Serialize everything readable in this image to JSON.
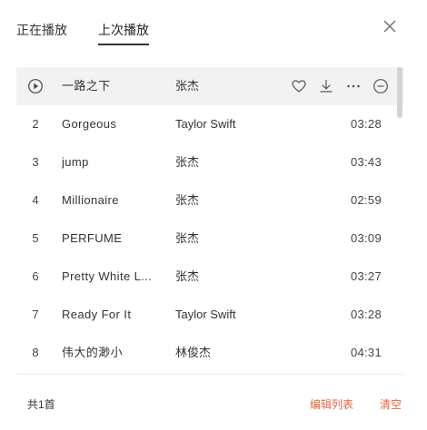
{
  "tabs": [
    {
      "label": "正在播放",
      "active": false
    },
    {
      "label": "上次播放",
      "active": true
    }
  ],
  "icons": {
    "close": "close-icon",
    "play": "play-circle-icon",
    "like": "heart-icon",
    "download": "download-icon",
    "more": "more-icon",
    "remove": "remove-circle-icon"
  },
  "tracks": [
    {
      "num": "",
      "title": "一路之下",
      "artist": "张杰",
      "duration": ""
    },
    {
      "num": "2",
      "title": "Gorgeous",
      "artist": "Taylor Swift",
      "duration": "03:28"
    },
    {
      "num": "3",
      "title": "jump",
      "artist": "张杰",
      "duration": "03:43"
    },
    {
      "num": "4",
      "title": "Millionaire",
      "artist": "张杰",
      "duration": "02:59"
    },
    {
      "num": "5",
      "title": "PERFUME",
      "artist": "张杰",
      "duration": "03:09"
    },
    {
      "num": "6",
      "title": "Pretty White L...",
      "artist": "张杰",
      "duration": "03:27"
    },
    {
      "num": "7",
      "title": "Ready For It",
      "artist": "Taylor Swift",
      "duration": "03:28"
    },
    {
      "num": "8",
      "title": "伟大的渺小",
      "artist": "林俊杰",
      "duration": "04:31"
    }
  ],
  "footer": {
    "count": "共1首",
    "edit_label": "编辑列表",
    "clear_label": "清空"
  },
  "colors": {
    "accent": "#e8643c",
    "current_row_bg": "#f2f2f2"
  }
}
